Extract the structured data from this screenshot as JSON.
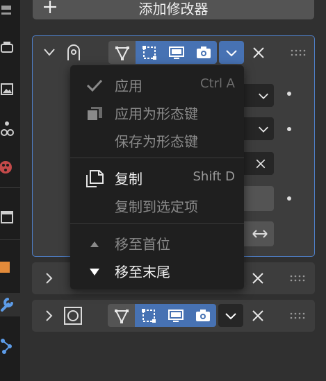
{
  "add_modifier": {
    "label": "添加修改器",
    "icon": "plus-icon"
  },
  "tabs": [
    {
      "name": "tool-tab",
      "icon": "wrench-screwdriver-icon"
    },
    {
      "name": "render-tab",
      "icon": "printer-icon"
    },
    {
      "name": "output-tab",
      "icon": "image-icon"
    },
    {
      "name": "view-layer-tab",
      "icon": "view-layer-icon"
    },
    {
      "name": "scene-tab",
      "icon": "scene-icon"
    },
    {
      "name": "world-tab",
      "icon": "world-icon"
    },
    {
      "name": "collection-tab",
      "icon": "collection-icon"
    },
    {
      "name": "object-tab",
      "icon": "object-icon"
    },
    {
      "name": "modifier-tab",
      "icon": "wrench-icon",
      "active": true
    },
    {
      "name": "particles-tab",
      "icon": "particles-icon"
    }
  ],
  "modifiers": [
    {
      "icon": "curve-arc-icon",
      "expanded": true,
      "selected": true
    },
    {
      "icon": "modifier-icon",
      "expanded": false
    },
    {
      "icon": "circle-modifier-icon",
      "expanded": false
    }
  ],
  "context_menu": {
    "items": [
      {
        "label": "应用",
        "shortcut": "Ctrl A",
        "icon": "checkmark-icon",
        "enabled": false
      },
      {
        "label": "应用为形态键",
        "shortcut": "",
        "icon": "shape-key-icon",
        "enabled": false
      },
      {
        "label": "保存为形态键",
        "shortcut": "",
        "icon": "",
        "enabled": false
      },
      {
        "label": "复制",
        "shortcut": "Shift D",
        "icon": "duplicate-icon",
        "enabled": true
      },
      {
        "label": "复制到选定项",
        "shortcut": "",
        "icon": "",
        "enabled": false
      },
      {
        "label": "移至首位",
        "shortcut": "",
        "icon": "triangle-up-icon",
        "enabled": false
      },
      {
        "label": "移至末尾",
        "shortcut": "",
        "icon": "triangle-down-icon",
        "enabled": true
      }
    ]
  },
  "colors": {
    "accent_blue": "#4772b3",
    "selection_outline": "#4f7fc7",
    "menu_bg": "#1f1f1f",
    "panel_bg": "#303030"
  }
}
